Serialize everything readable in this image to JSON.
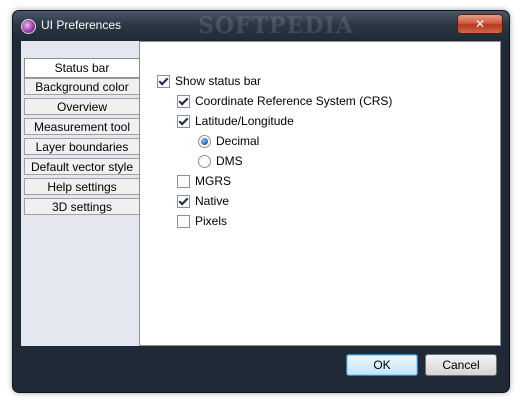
{
  "window": {
    "title": "UI Preferences",
    "watermark": "SOFTPEDIA",
    "close_glyph": "✕"
  },
  "sidebar": {
    "items": [
      {
        "label": "Status bar",
        "selected": true
      },
      {
        "label": "Background color",
        "selected": false
      },
      {
        "label": "Overview",
        "selected": false
      },
      {
        "label": "Measurement tool",
        "selected": false
      },
      {
        "label": "Layer boundaries",
        "selected": false
      },
      {
        "label": "Default vector style",
        "selected": false
      },
      {
        "label": "Help settings",
        "selected": false
      },
      {
        "label": "3D settings",
        "selected": false
      }
    ]
  },
  "status_bar": {
    "show_status_bar": {
      "label": "Show status bar",
      "checked": true
    },
    "crs": {
      "label": "Coordinate Reference System (CRS)",
      "checked": true
    },
    "latlon": {
      "label": "Latitude/Longitude",
      "checked": true
    },
    "decimal": {
      "label": "Decimal",
      "selected": true
    },
    "dms": {
      "label": "DMS",
      "selected": false
    },
    "mgrs": {
      "label": "MGRS",
      "checked": false
    },
    "native": {
      "label": "Native",
      "checked": true
    },
    "pixels": {
      "label": "Pixels",
      "checked": false
    }
  },
  "buttons": {
    "ok": "OK",
    "cancel": "Cancel"
  }
}
